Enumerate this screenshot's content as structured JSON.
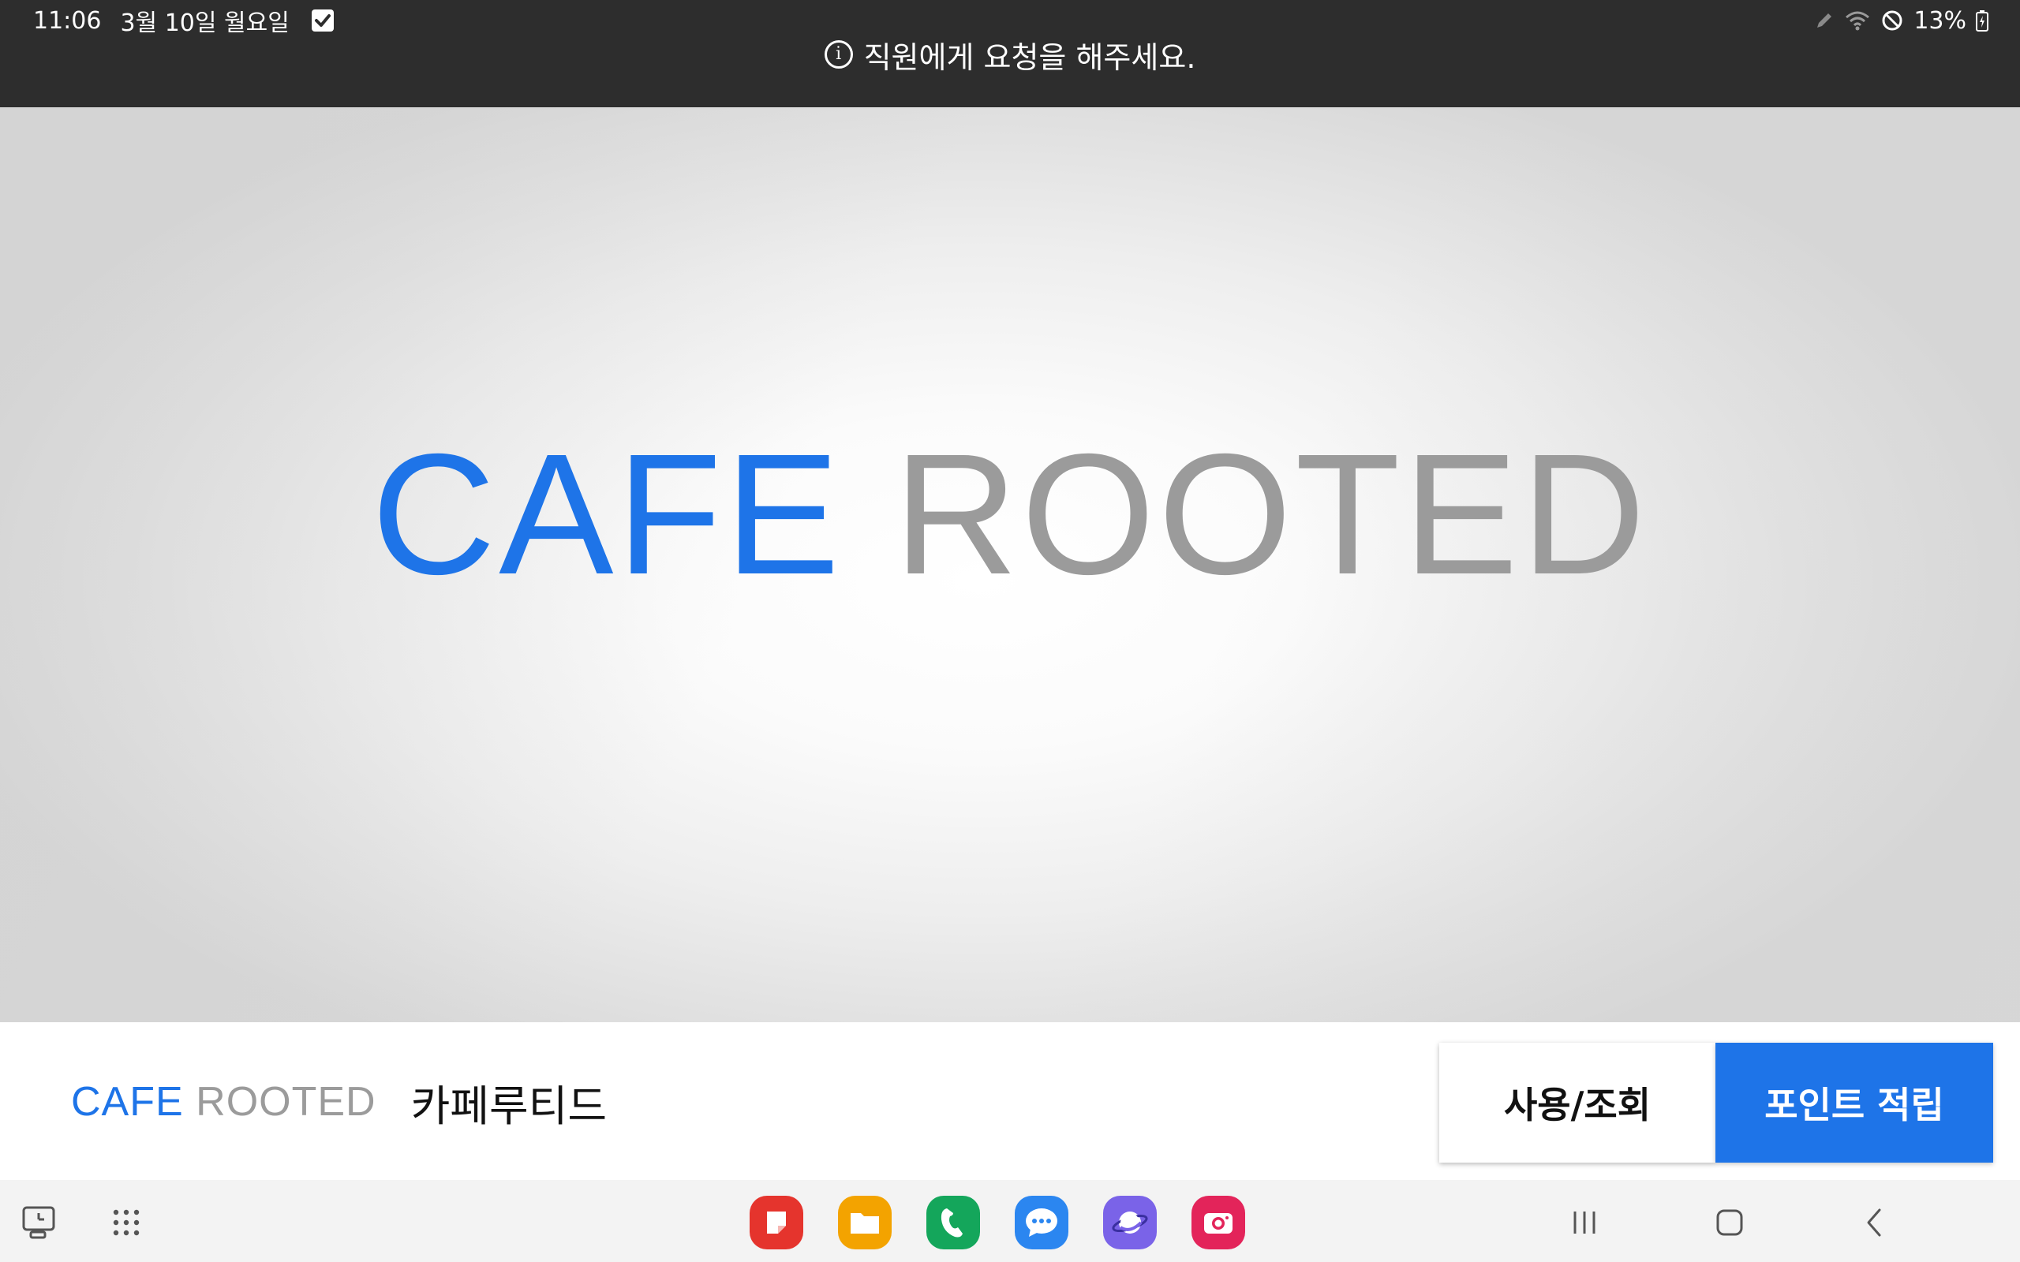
{
  "status_bar": {
    "time": "11:06",
    "date": "3월 10일 월요일",
    "battery": "13%"
  },
  "notice": {
    "info_glyph": "i",
    "text": "직원에게 요청을 해주세요."
  },
  "hero": {
    "logo_primary": "CAFE",
    "logo_secondary": "ROOTED"
  },
  "action_bar": {
    "brand_primary": "CAFE",
    "brand_secondary": "ROOTED",
    "brand_korean": "카페루티드",
    "use_button_label": "사용/조회",
    "earn_button_label": "포인트 적립"
  },
  "taskbar": {
    "left_icons": [
      "recent-screen-icon",
      "app-grid-icon"
    ],
    "dock_apps": [
      "notes-app-icon",
      "files-app-icon",
      "phone-app-icon",
      "messages-app-icon",
      "browser-app-icon",
      "camera-app-icon"
    ],
    "nav_buttons": [
      "recents-nav-icon",
      "home-nav-icon",
      "back-nav-icon"
    ]
  },
  "colors": {
    "accent_blue": "#1e74e8",
    "logo_grey": "#9b9b9b",
    "topbar": "#2d2d2d"
  }
}
